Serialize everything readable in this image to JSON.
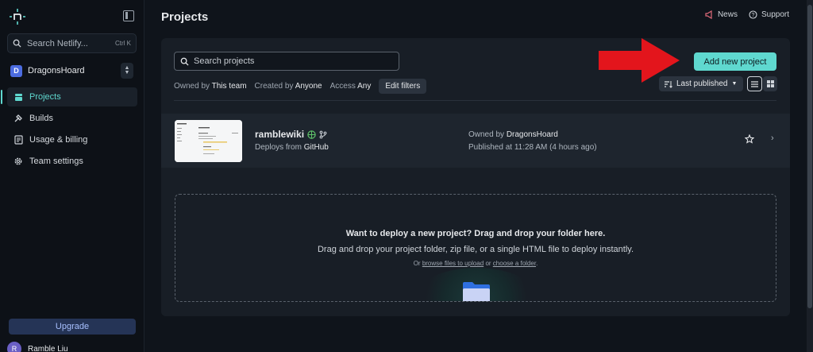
{
  "sidebar": {
    "search_placeholder": "Search Netlify...",
    "search_shortcut": "Ctrl K",
    "team": {
      "initial": "D",
      "name": "DragonsHoard"
    },
    "nav": [
      {
        "label": "Projects",
        "icon": "projects-icon",
        "active": true
      },
      {
        "label": "Builds",
        "icon": "builds-icon",
        "active": false
      },
      {
        "label": "Usage & billing",
        "icon": "billing-icon",
        "active": false
      },
      {
        "label": "Team settings",
        "icon": "gear-icon",
        "active": false
      }
    ],
    "upgrade_label": "Upgrade",
    "user": {
      "initial": "R",
      "name": "Ramble Liu"
    }
  },
  "header": {
    "title": "Projects",
    "news_label": "News",
    "support_label": "Support"
  },
  "toolbar": {
    "search_placeholder": "Search projects",
    "filters": {
      "owned_prefix": "Owned by",
      "owned_value": "This team",
      "created_prefix": "Created by",
      "created_value": "Anyone",
      "access_prefix": "Access",
      "access_value": "Any",
      "edit_label": "Edit filters"
    },
    "add_label": "Add new project",
    "sort_label": "Last published"
  },
  "projects": [
    {
      "name": "ramblewiki",
      "deploy_prefix": "Deploys from",
      "deploy_source": "GitHub",
      "owner_prefix": "Owned by",
      "owner": "DragonsHoard",
      "published": "Published at 11:28 AM (4 hours ago)"
    }
  ],
  "dropzone": {
    "title": "Want to deploy a new project? Drag and drop your folder here.",
    "subtitle": "Drag and drop your project folder, zip file, or a single HTML file to deploy instantly.",
    "or_text": "Or",
    "browse_link": "browse files to upload",
    "or_text2": "or",
    "choose_link": "choose a folder",
    "end": "."
  },
  "colors": {
    "accent": "#5fd8cf",
    "annotation_arrow": "#e3151c",
    "background": "#0f141b",
    "panel": "#181e26"
  }
}
